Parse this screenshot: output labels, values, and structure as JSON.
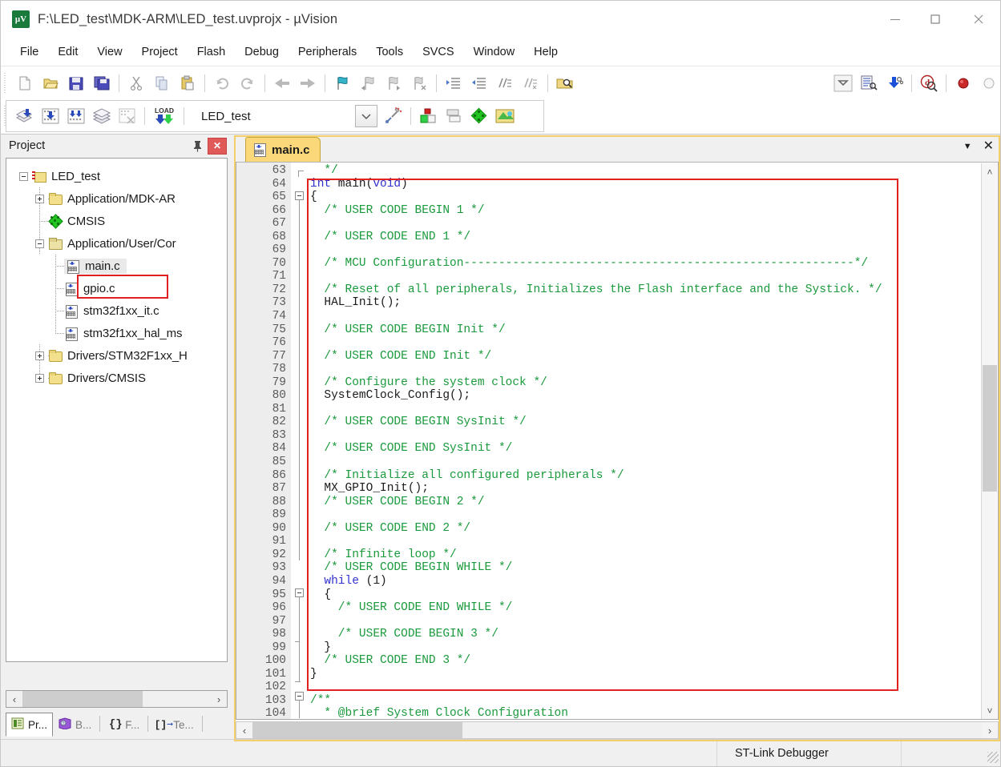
{
  "window": {
    "title": "F:\\LED_test\\MDK-ARM\\LED_test.uvprojx - µVision",
    "app_icon": "uvision-icon",
    "minimize": "—",
    "maximize": "□",
    "close": "✕"
  },
  "menu": {
    "items": [
      "File",
      "Edit",
      "View",
      "Project",
      "Flash",
      "Debug",
      "Peripherals",
      "Tools",
      "SVCS",
      "Window",
      "Help"
    ]
  },
  "toolbar_main": {
    "buttons": [
      "new-file-icon",
      "open-file-icon",
      "save-icon",
      "save-all-icon",
      "cut-icon",
      "copy-icon",
      "paste-icon",
      "undo-icon",
      "redo-icon",
      "navigate-back-icon",
      "navigate-forward-icon",
      "insert-bookmark-icon",
      "prev-bookmark-icon",
      "next-bookmark-icon",
      "clear-bookmarks-icon",
      "indent-icon",
      "outdent-icon",
      "comment-icon",
      "uncomment-icon",
      "find-in-files-icon",
      "configure-toolbar-icon",
      "text-browse-icon",
      "download-icon",
      "start-debug-icon",
      "insert-breakpoint-icon",
      "disable-breakpoint-icon"
    ]
  },
  "toolbar_build": {
    "buttons": [
      "translate-icon",
      "build-icon",
      "rebuild-icon",
      "batch-build-icon",
      "stop-build-icon",
      "download-load-icon"
    ],
    "target_value": "LED_test",
    "after_buttons": [
      "target-options-icon",
      "manage-run-environment-icon",
      "manage-project-items-icon",
      "manage-components-icon",
      "pack-installer-icon"
    ]
  },
  "project_panel": {
    "title": "Project",
    "pin_icon": "pin-icon",
    "close_icon": "close-icon",
    "tree": [
      {
        "label": "LED_test",
        "icon": "project-icon",
        "depth": 0,
        "state": "expanded"
      },
      {
        "label": "Application/MDK-AR",
        "icon": "folder-icon",
        "depth": 1,
        "state": "collapsed"
      },
      {
        "label": "CMSIS",
        "icon": "cmsis-icon",
        "depth": 1,
        "state": "leaf"
      },
      {
        "label": "Application/User/Cor",
        "icon": "folder-open-icon",
        "depth": 1,
        "state": "expanded"
      },
      {
        "label": "main.c",
        "icon": "c-file-icon",
        "depth": 2,
        "state": "leaf",
        "selected": true
      },
      {
        "label": "gpio.c",
        "icon": "c-file-icon",
        "depth": 2,
        "state": "leaf"
      },
      {
        "label": "stm32f1xx_it.c",
        "icon": "c-file-icon",
        "depth": 2,
        "state": "leaf"
      },
      {
        "label": "stm32f1xx_hal_ms",
        "icon": "c-file-icon",
        "depth": 2,
        "state": "leaf"
      },
      {
        "label": "Drivers/STM32F1xx_H",
        "icon": "folder-icon",
        "depth": 1,
        "state": "collapsed"
      },
      {
        "label": "Drivers/CMSIS",
        "icon": "folder-icon",
        "depth": 1,
        "state": "collapsed"
      }
    ],
    "scroll_left_arrow": "‹",
    "scroll_right_arrow": "›",
    "bottom_tabs": [
      {
        "label": "Pr...",
        "icon": "project-tab-icon",
        "active": true
      },
      {
        "label": "B...",
        "icon": "books-tab-icon",
        "active": false
      },
      {
        "label": "F...",
        "icon": "functions-tab-icon",
        "active": false
      },
      {
        "label": "Te...",
        "icon": "templates-tab-icon",
        "active": false
      }
    ]
  },
  "editor": {
    "tab": {
      "label": "main.c",
      "icon": "c-file-icon"
    },
    "tabbar_caret": "▼",
    "tabbar_close": "✕",
    "scroll_up_arrow": "˄",
    "scroll_down_arrow": "˅",
    "hscroll_left_arrow": "‹",
    "hscroll_right_arrow": "›",
    "first_line": 63,
    "highlight_box_color": "#e22121",
    "lines": [
      {
        "n": 63,
        "fold": "end",
        "tokens": [
          {
            "t": "  */",
            "c": "cm"
          }
        ]
      },
      {
        "n": 64,
        "fold": "",
        "tokens": [
          {
            "t": "int",
            "c": "kw"
          },
          {
            "t": " main(",
            "c": "pl"
          },
          {
            "t": "void",
            "c": "kw"
          },
          {
            "t": ")",
            "c": "pl"
          }
        ]
      },
      {
        "n": 65,
        "fold": "open",
        "tokens": [
          {
            "t": "{",
            "c": "pl"
          }
        ]
      },
      {
        "n": 66,
        "fold": "",
        "tokens": [
          {
            "t": "  /* USER CODE BEGIN 1 */",
            "c": "cm"
          }
        ]
      },
      {
        "n": 67,
        "fold": "",
        "tokens": []
      },
      {
        "n": 68,
        "fold": "",
        "tokens": [
          {
            "t": "  /* USER CODE END 1 */",
            "c": "cm"
          }
        ]
      },
      {
        "n": 69,
        "fold": "",
        "tokens": []
      },
      {
        "n": 70,
        "fold": "",
        "tokens": [
          {
            "t": "  /* MCU Configuration--------------------------------------------------------*/",
            "c": "cm"
          }
        ]
      },
      {
        "n": 71,
        "fold": "",
        "tokens": []
      },
      {
        "n": 72,
        "fold": "",
        "tokens": [
          {
            "t": "  /* Reset of all peripherals, Initializes the Flash interface and the Systick. */",
            "c": "cm"
          }
        ]
      },
      {
        "n": 73,
        "fold": "",
        "tokens": [
          {
            "t": "  HAL_Init();",
            "c": "pl"
          }
        ]
      },
      {
        "n": 74,
        "fold": "",
        "tokens": []
      },
      {
        "n": 75,
        "fold": "",
        "tokens": [
          {
            "t": "  /* USER CODE BEGIN Init */",
            "c": "cm"
          }
        ]
      },
      {
        "n": 76,
        "fold": "",
        "tokens": []
      },
      {
        "n": 77,
        "fold": "",
        "tokens": [
          {
            "t": "  /* USER CODE END Init */",
            "c": "cm"
          }
        ]
      },
      {
        "n": 78,
        "fold": "",
        "tokens": []
      },
      {
        "n": 79,
        "fold": "",
        "tokens": [
          {
            "t": "  /* Configure the system clock */",
            "c": "cm"
          }
        ]
      },
      {
        "n": 80,
        "fold": "",
        "tokens": [
          {
            "t": "  SystemClock_Config();",
            "c": "pl"
          }
        ]
      },
      {
        "n": 81,
        "fold": "",
        "tokens": []
      },
      {
        "n": 82,
        "fold": "",
        "tokens": [
          {
            "t": "  /* USER CODE BEGIN SysInit */",
            "c": "cm"
          }
        ]
      },
      {
        "n": 83,
        "fold": "",
        "tokens": []
      },
      {
        "n": 84,
        "fold": "",
        "tokens": [
          {
            "t": "  /* USER CODE END SysInit */",
            "c": "cm"
          }
        ]
      },
      {
        "n": 85,
        "fold": "",
        "tokens": []
      },
      {
        "n": 86,
        "fold": "",
        "tokens": [
          {
            "t": "  /* Initialize all configured peripherals */",
            "c": "cm"
          }
        ]
      },
      {
        "n": 87,
        "fold": "",
        "tokens": [
          {
            "t": "  MX_GPIO_Init();",
            "c": "pl"
          }
        ]
      },
      {
        "n": 88,
        "fold": "",
        "tokens": [
          {
            "t": "  /* USER CODE BEGIN 2 */",
            "c": "cm"
          }
        ]
      },
      {
        "n": 89,
        "fold": "",
        "tokens": []
      },
      {
        "n": 90,
        "fold": "",
        "tokens": [
          {
            "t": "  /* USER CODE END 2 */",
            "c": "cm"
          }
        ]
      },
      {
        "n": 91,
        "fold": "",
        "tokens": []
      },
      {
        "n": 92,
        "fold": "",
        "tokens": [
          {
            "t": "  /* Infinite loop */",
            "c": "cm"
          }
        ]
      },
      {
        "n": 93,
        "fold": "",
        "tokens": [
          {
            "t": "  /* USER CODE BEGIN WHILE */",
            "c": "cm"
          }
        ]
      },
      {
        "n": 94,
        "fold": "",
        "tokens": [
          {
            "t": "  ",
            "c": "pl"
          },
          {
            "t": "while",
            "c": "kw"
          },
          {
            "t": " (1)",
            "c": "pl"
          }
        ]
      },
      {
        "n": 95,
        "fold": "open",
        "tokens": [
          {
            "t": "  {",
            "c": "pl"
          }
        ]
      },
      {
        "n": 96,
        "fold": "",
        "tokens": [
          {
            "t": "    /* USER CODE END WHILE */",
            "c": "cm"
          }
        ]
      },
      {
        "n": 97,
        "fold": "",
        "tokens": []
      },
      {
        "n": 98,
        "fold": "",
        "tokens": [
          {
            "t": "    /* USER CODE BEGIN 3 */",
            "c": "cm"
          }
        ]
      },
      {
        "n": 99,
        "fold": "close",
        "tokens": [
          {
            "t": "  }",
            "c": "pl"
          }
        ]
      },
      {
        "n": 100,
        "fold": "",
        "tokens": [
          {
            "t": "  /* USER CODE END 3 */",
            "c": "cm"
          }
        ]
      },
      {
        "n": 101,
        "fold": "",
        "tokens": [
          {
            "t": "}",
            "c": "pl"
          }
        ]
      },
      {
        "n": 102,
        "fold": "end",
        "tokens": []
      },
      {
        "n": 103,
        "fold": "open",
        "tokens": [
          {
            "t": "/**",
            "c": "cm"
          }
        ]
      },
      {
        "n": 104,
        "fold": "",
        "tokens": [
          {
            "t": "  * @brief System Clock Configuration",
            "c": "cm"
          }
        ]
      }
    ]
  },
  "statusbar": {
    "debugger": "ST-Link Debugger"
  }
}
